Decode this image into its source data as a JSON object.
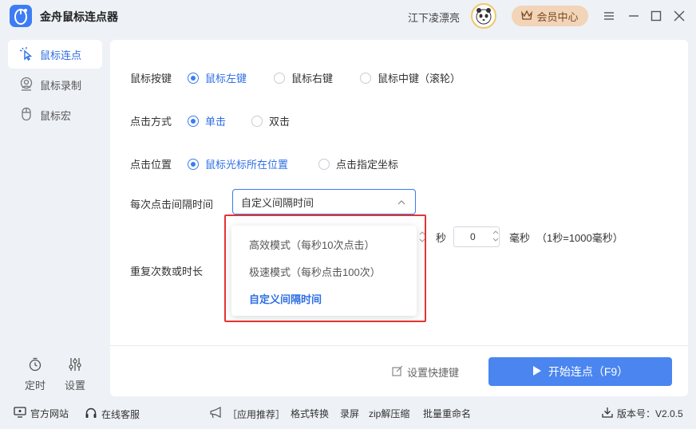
{
  "app": {
    "title": "金舟鼠标连点器",
    "username": "江下凌漂亮",
    "vip_label": "会员中心"
  },
  "sidebar": {
    "items": [
      {
        "label": "鼠标连点",
        "icon": "cursor-click-icon"
      },
      {
        "label": "鼠标录制",
        "icon": "record-icon"
      },
      {
        "label": "鼠标宏",
        "icon": "mouse-icon"
      }
    ],
    "timer_label": "定时",
    "settings_label": "设置"
  },
  "main": {
    "mouse_button": {
      "label": "鼠标按键",
      "options": [
        "鼠标左键",
        "鼠标右键",
        "鼠标中键（滚轮）"
      ],
      "selected": 0
    },
    "click_mode": {
      "label": "点击方式",
      "options": [
        "单击",
        "双击"
      ],
      "selected": 0
    },
    "click_position": {
      "label": "点击位置",
      "options": [
        "鼠标光标所在位置",
        "点击指定坐标"
      ],
      "selected": 0
    },
    "interval": {
      "label": "每次点击间隔时间",
      "value": "自定义间隔时间",
      "seconds_unit": "秒",
      "ms_value": "0",
      "ms_unit": "毫秒",
      "note": "（1秒=1000毫秒）"
    },
    "repeat_label": "重复次数或时长",
    "shortcut_label": "设置快捷键",
    "start_label": "开始连点（F9）"
  },
  "dropdown": {
    "options": [
      "高效模式（每秒10次点击）",
      "极速模式（每秒点击100次）",
      "自定义间隔时间"
    ],
    "selected": 2
  },
  "footer": {
    "website": "官方网站",
    "support": "在线客服",
    "recommend": "［应用推荐］",
    "links": [
      "格式转换",
      "录屏",
      "zip解压缩",
      "批量重命名"
    ],
    "version": "版本号：V2.0.5"
  },
  "colors": {
    "accent": "#3b7cf0",
    "highlight": "#e53333",
    "vip_bg": "#f2d4b8"
  }
}
